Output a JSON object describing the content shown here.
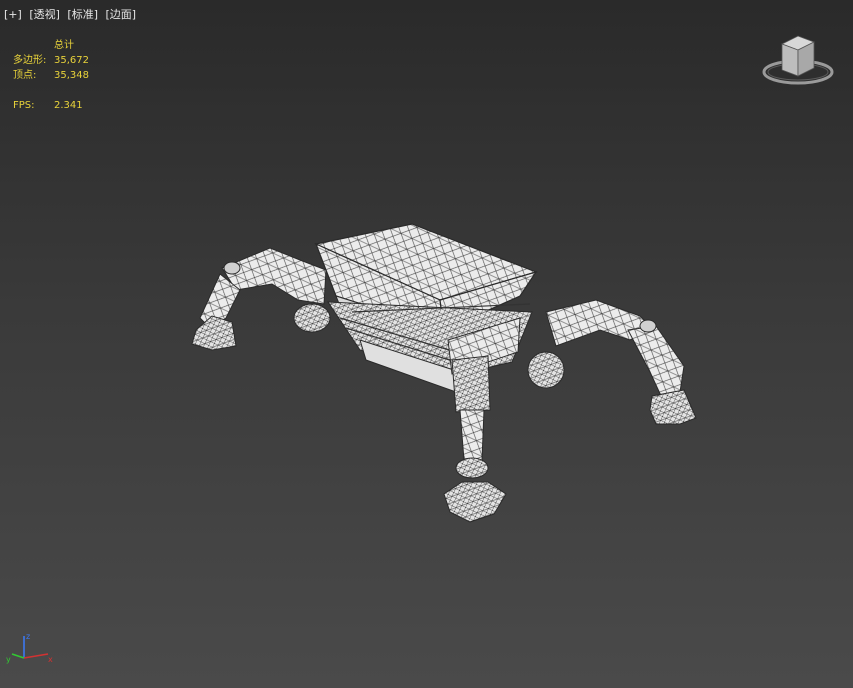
{
  "viewport": {
    "menu_plus": "[+]",
    "view_type": "[透视]",
    "shading_mode": "[标准]",
    "display_mode": "[边面]"
  },
  "statistics": {
    "header": "总计",
    "polygons_label": "多边形:",
    "polygons_value": "35,672",
    "vertices_label": "顶点:",
    "vertices_value": "35,348",
    "fps_label": "FPS:",
    "fps_value": "2.341"
  },
  "axis_gizmo": {
    "z_label": "z",
    "x_label": "x",
    "y_label": "y"
  },
  "colors": {
    "stats_text": "#e8d23a",
    "wire": "#2a2a2a",
    "fill": "#e9e9e9",
    "axis_x": "#d23232",
    "axis_y": "#32c832",
    "axis_z": "#3c78f0"
  },
  "icons": {
    "viewcube": "view-cube-icon",
    "axis": "axis-tripod-icon"
  }
}
